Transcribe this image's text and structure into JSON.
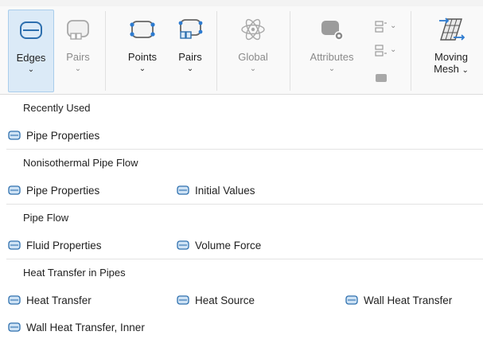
{
  "ribbon": {
    "buttons": [
      {
        "label": "Edges",
        "chevron": "⌄",
        "icon": "edge-pipe-icon",
        "state": "active"
      },
      {
        "label": "Pairs",
        "chevron": "⌄",
        "icon": "pipe-pairs-icon",
        "state": "disabled"
      },
      {
        "label": "Points",
        "chevron": "⌄",
        "icon": "pipe-points-icon",
        "state": "enabled"
      },
      {
        "label": "Pairs",
        "chevron": "⌄",
        "icon": "point-pairs-icon",
        "state": "enabled"
      },
      {
        "label": "Global",
        "chevron": "⌄",
        "icon": "atom-icon",
        "state": "disabled"
      },
      {
        "label": "Attributes",
        "chevron": "⌄",
        "icon": "pipe-gear-icon",
        "state": "disabled"
      },
      {
        "label": "Moving",
        "label2": "Mesh",
        "chevron": "⌄",
        "icon": "moving-mesh-icon",
        "state": "enabled"
      }
    ],
    "small_chevrons": [
      "⌄",
      "⌄"
    ]
  },
  "menu": {
    "sections": [
      {
        "title": "Recently Used",
        "items": [
          "Pipe Properties"
        ]
      },
      {
        "title": "Nonisothermal Pipe Flow",
        "items": [
          "Pipe Properties",
          "Initial Values"
        ]
      },
      {
        "title": "Pipe Flow",
        "items": [
          "Fluid Properties",
          "Volume Force"
        ]
      },
      {
        "title": "Heat Transfer in Pipes",
        "items": [
          "Heat Transfer",
          "Heat Source",
          "Wall Heat Transfer",
          "Wall Heat Transfer, Inner"
        ]
      }
    ]
  },
  "colors": {
    "accent": "#1f6fb5",
    "active_bg": "#dbeaf7",
    "disabled": "#8a8a8a"
  }
}
